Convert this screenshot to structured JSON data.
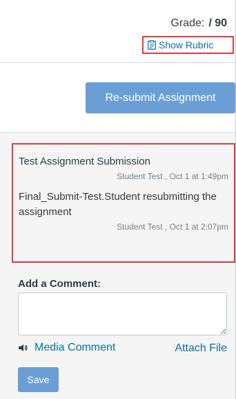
{
  "grade": {
    "label": "Grade:",
    "value": "/ 90"
  },
  "rubric": {
    "label": "Show Rubric",
    "icon": "clipboard-icon"
  },
  "submission": {
    "resubmit_label": "Re-submit Assignment"
  },
  "comments": [
    {
      "text": "Test Assignment Submission",
      "meta": "Student Test , Oct 1 at 1:49pm"
    },
    {
      "text": "Final_Submit-Test.Student resubmitting the assignment",
      "meta": "Student Test , Oct 1 at 2:07pm"
    }
  ],
  "comment_form": {
    "label": "Add a Comment:",
    "textarea_value": "",
    "media_comment_label": "Media Comment",
    "media_icon": "speaker-icon",
    "attach_file_label": "Attach File",
    "save_label": "Save"
  },
  "colors": {
    "link": "#0770a3",
    "button": "#6a9fd5",
    "highlight_border": "#e03a3e",
    "panel_bg": "#f5f5f5"
  }
}
